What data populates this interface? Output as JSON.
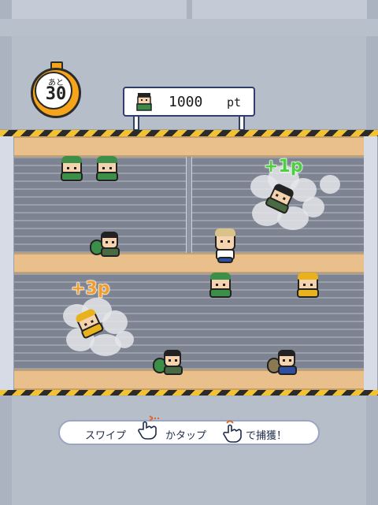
{
  "hud": {
    "timer_prefix": "あと",
    "timer_value": "30",
    "score_value": "1000",
    "score_unit": "pt"
  },
  "popups": {
    "plus_one": "+1p",
    "plus_three": "+3p"
  },
  "instruction": {
    "part1": "スワイプ",
    "part2": "かタップ",
    "part3": "で捕獲！"
  },
  "icons": {
    "timer": "stopwatch-icon",
    "score": "thief-icon",
    "swipe": "swipe-hand-icon",
    "tap": "tap-hand-icon"
  },
  "colors": {
    "timer_accent": "#f6a41a",
    "hazard_yellow": "#f2c230",
    "beam": "#e9c08b",
    "plus_one": "#4ccf3f",
    "plus_three": "#f29c2c",
    "instruction_text": "#1e2a48"
  }
}
